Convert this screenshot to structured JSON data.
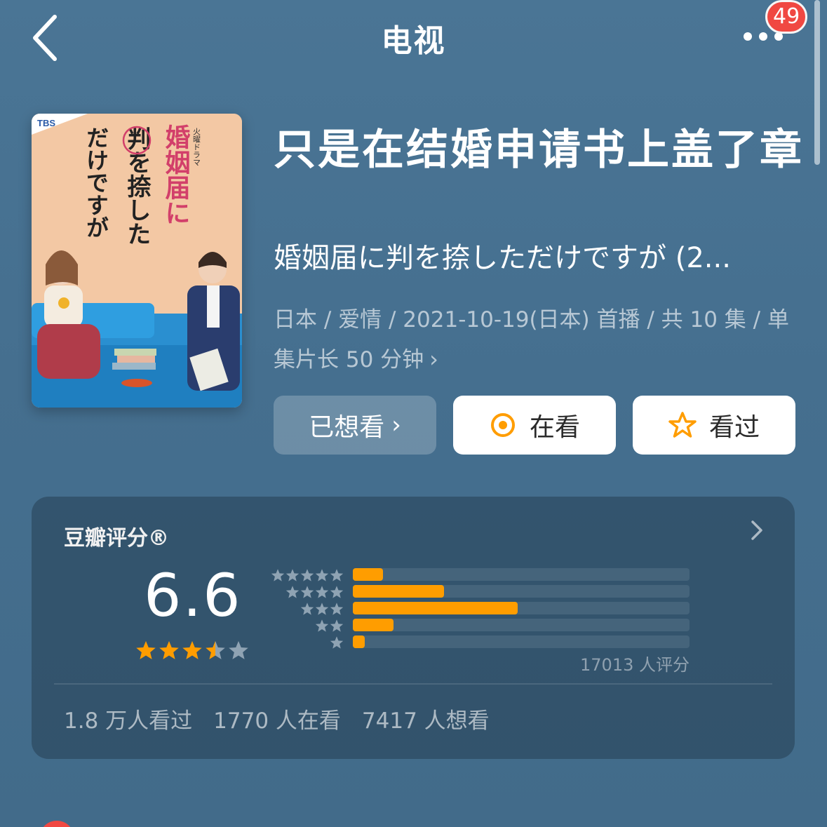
{
  "nav": {
    "title": "电视",
    "badge": "49"
  },
  "poster": {
    "network": "TBS",
    "slot": "火曜ドラマ",
    "title_line1": "婚姻届に",
    "title_line2": "判を捺した",
    "title_line3": "だけですが",
    "stamp_char": "判"
  },
  "show": {
    "title": "只是在结婚申请书上盖了章",
    "original_title": "婚姻届に判を捺しただけですが (2...",
    "meta": "日本 / 爱情 / 2021-10-19(日本) 首播 / 共 10 集 / 单集片长 50 分钟"
  },
  "actions": {
    "wish_label": "已想看",
    "doing_label": "在看",
    "done_label": "看过"
  },
  "rating": {
    "title": "豆瓣评分®",
    "score": "6.6",
    "score_stars": 3.5,
    "distribution": [
      {
        "stars": 5,
        "fraction": 0.09
      },
      {
        "stars": 4,
        "fraction": 0.27
      },
      {
        "stars": 3,
        "fraction": 0.49
      },
      {
        "stars": 2,
        "fraction": 0.12
      },
      {
        "stars": 1,
        "fraction": 0.035
      }
    ],
    "raters": "17013 人评分",
    "watched": "1.8 万人看过",
    "watching": "1770 人在看",
    "wish": "7417 人想看"
  },
  "colors": {
    "accent": "#ff9d00",
    "badge": "#f04842",
    "background": "#4a7595"
  }
}
